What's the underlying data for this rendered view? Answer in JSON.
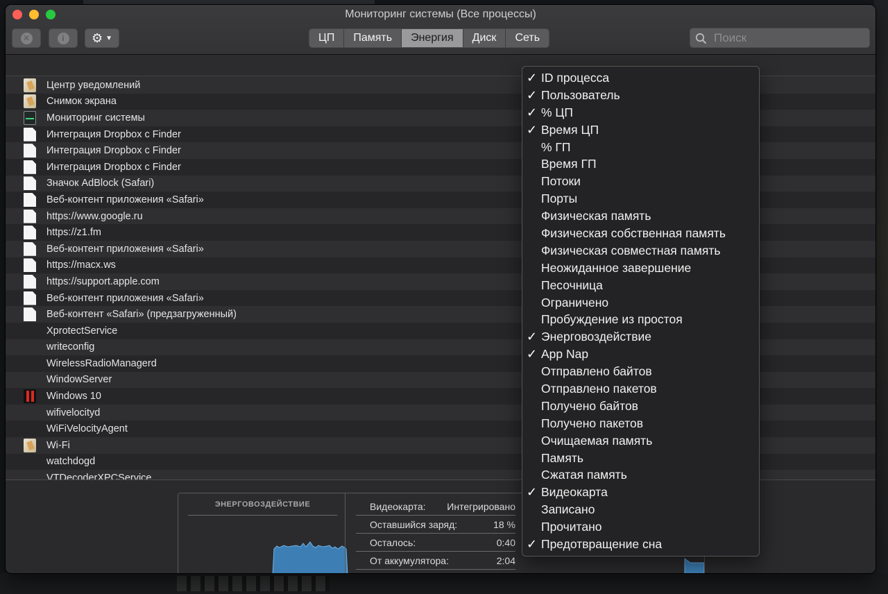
{
  "window": {
    "title": "Мониторинг системы (Все процессы)"
  },
  "toolbar": {
    "close_icon": "x-circle-icon",
    "info_icon": "info-icon",
    "info_glyph": "i",
    "gear_icon": "gear-icon"
  },
  "tabs": [
    {
      "label": "ЦП",
      "active": false
    },
    {
      "label": "Память",
      "active": false
    },
    {
      "label": "Энергия",
      "active": true
    },
    {
      "label": "Диск",
      "active": false
    },
    {
      "label": "Сеть",
      "active": false
    }
  ],
  "search": {
    "placeholder": "Поиск",
    "value": ""
  },
  "processes": [
    {
      "name": "Центр уведомлений",
      "icon": "app"
    },
    {
      "name": "Снимок экрана",
      "icon": "app"
    },
    {
      "name": "Мониторинг системы",
      "icon": "mon"
    },
    {
      "name": "Интеграция Dropbox с Finder",
      "icon": "doc"
    },
    {
      "name": "Интеграция Dropbox с Finder",
      "icon": "doc"
    },
    {
      "name": "Интеграция Dropbox с Finder",
      "icon": "doc"
    },
    {
      "name": "Значок AdBlock (Safari)",
      "icon": "doc"
    },
    {
      "name": "Веб-контент приложения «Safari»",
      "icon": "doc"
    },
    {
      "name": "https://www.google.ru",
      "icon": "doc"
    },
    {
      "name": "https://z1.fm",
      "icon": "doc"
    },
    {
      "name": "Веб-контент приложения «Safari»",
      "icon": "doc"
    },
    {
      "name": "https://macx.ws",
      "icon": "doc"
    },
    {
      "name": "https://support.apple.com",
      "icon": "doc"
    },
    {
      "name": "Веб-контент приложения «Safari»",
      "icon": "doc"
    },
    {
      "name": "Веб-контент «Safari» (предзагруженный)",
      "icon": "doc"
    },
    {
      "name": "XprotectService",
      "icon": "none"
    },
    {
      "name": "writeconfig",
      "icon": "none"
    },
    {
      "name": "WirelessRadioManagerd",
      "icon": "none"
    },
    {
      "name": "WindowServer",
      "icon": "none"
    },
    {
      "name": "Windows 10",
      "icon": "win10"
    },
    {
      "name": "wifivelocityd",
      "icon": "none"
    },
    {
      "name": "WiFiVelocityAgent",
      "icon": "none"
    },
    {
      "name": "Wi-Fi",
      "icon": "app"
    },
    {
      "name": "watchdogd",
      "icon": "none"
    },
    {
      "name": "VTDecoderXPCService",
      "icon": "none"
    }
  ],
  "energy_panel": {
    "graph_title": "ЭНЕРГОВОЗДЕЙСТВИЕ",
    "stats": [
      {
        "label": "Видеокарта:",
        "value": "Интегрировано"
      },
      {
        "label": "Оставшийся заряд:",
        "value": "18 %"
      },
      {
        "label": "Осталось:",
        "value": "0:40"
      },
      {
        "label": "От аккумулятора:",
        "value": "2:04"
      }
    ]
  },
  "column_menu": {
    "items": [
      {
        "label": "ID процесса",
        "checked": true
      },
      {
        "label": "Пользователь",
        "checked": true
      },
      {
        "label": "% ЦП",
        "checked": true
      },
      {
        "label": "Время ЦП",
        "checked": true
      },
      {
        "label": "% ГП",
        "checked": false
      },
      {
        "label": "Время ГП",
        "checked": false
      },
      {
        "label": "Потоки",
        "checked": false
      },
      {
        "label": "Порты",
        "checked": false
      },
      {
        "label": "Физическая память",
        "checked": false
      },
      {
        "label": "Физическая собственная память",
        "checked": false
      },
      {
        "label": "Физическая совместная память",
        "checked": false
      },
      {
        "label": "Неожиданное завершение",
        "checked": false
      },
      {
        "label": "Песочница",
        "checked": false
      },
      {
        "label": "Ограничено",
        "checked": false
      },
      {
        "label": "Пробуждение из простоя",
        "checked": false
      },
      {
        "label": "Энерговоздействие",
        "checked": true
      },
      {
        "label": "App Nap",
        "checked": true
      },
      {
        "label": "Отправлено байтов",
        "checked": false
      },
      {
        "label": "Отправлено пакетов",
        "checked": false
      },
      {
        "label": "Получено байтов",
        "checked": false
      },
      {
        "label": "Получено пакетов",
        "checked": false
      },
      {
        "label": "Очищаемая память",
        "checked": false
      },
      {
        "label": "Память",
        "checked": false
      },
      {
        "label": "Сжатая память",
        "checked": false
      },
      {
        "label": "Видеокарта",
        "checked": true
      },
      {
        "label": "Записано",
        "checked": false
      },
      {
        "label": "Прочитано",
        "checked": false
      },
      {
        "label": "Предотвращение сна",
        "checked": true
      }
    ],
    "check_glyph": "✓"
  },
  "colors": {
    "accent_active_tab": "#9a9a9c",
    "graph_fill": "#3d7fb5",
    "graph_line": "#6fb3ea"
  }
}
